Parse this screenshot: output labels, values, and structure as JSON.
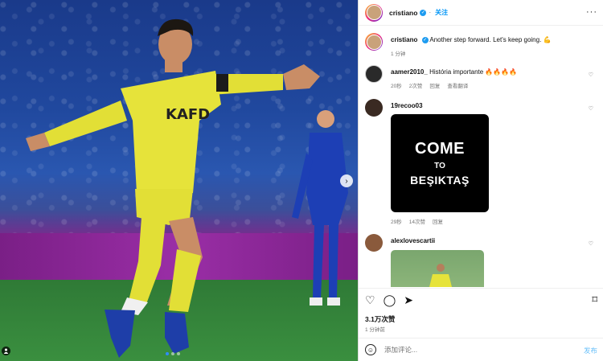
{
  "post": {
    "carousel_next": "›",
    "dots": 3,
    "active_dot": 0,
    "user_tag_icon": "person-icon"
  },
  "header": {
    "username": "cristiano",
    "follow_label": "关注",
    "more_label": "···"
  },
  "caption": {
    "username": "cristiano",
    "text": "Another step forward. Let's keep going. 💪",
    "time": "1 分钟"
  },
  "comments": [
    {
      "username": "aamer2010_",
      "text": "História importante 🔥🔥🔥🔥",
      "time": "20秒",
      "likes": "2次赞",
      "reply": "回复",
      "translate": "查看翻译"
    },
    {
      "username": "19recoo03",
      "image_lines": [
        "COME",
        "TO",
        "BEŞIKTAŞ"
      ],
      "time": "29秒",
      "likes": "14次赞",
      "reply": "回复"
    },
    {
      "username": "alexlovescartii"
    }
  ],
  "actions": {
    "likes": "3.1万次赞",
    "time": "1 分钟前"
  },
  "add_comment": {
    "placeholder": "添加评论...",
    "post_label": "发布"
  },
  "colors": {
    "accent": "#0095f6",
    "verified": "#1d9bf0",
    "jersey": "#e6e33a"
  }
}
